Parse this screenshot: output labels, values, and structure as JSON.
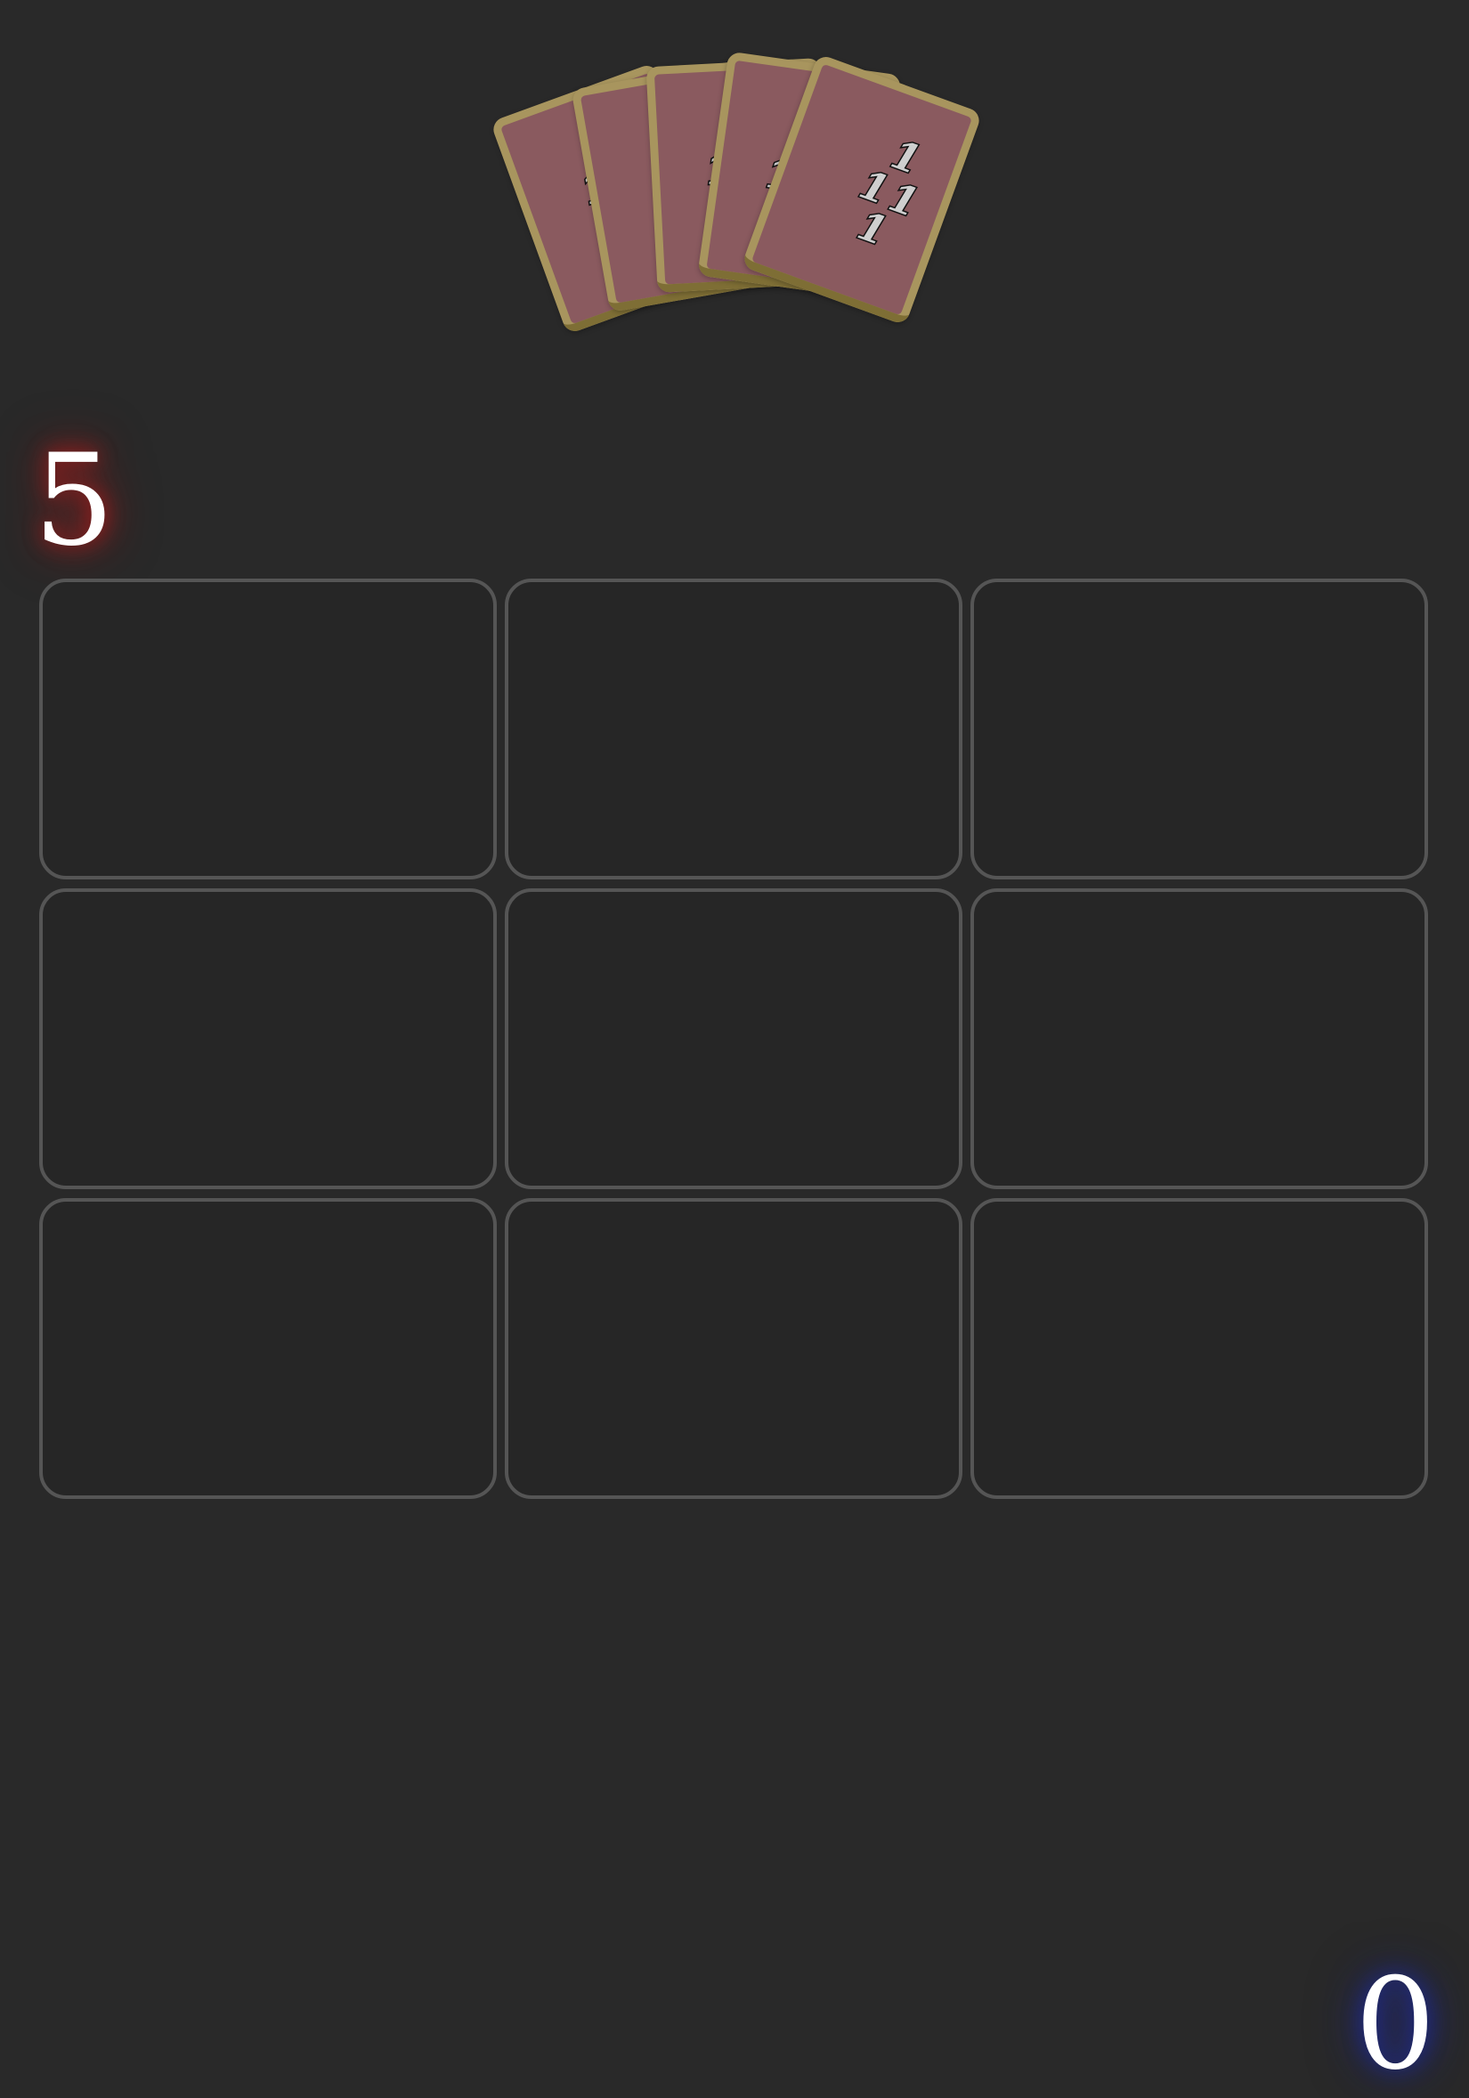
{
  "opponent": {
    "score": "5",
    "score_glow_color": "#9b1c1c",
    "hand": {
      "card_count": 5,
      "card_back_color": "#8a5a5f",
      "card_border_color": "#a8955e",
      "top_card_digits": [
        "1",
        "1",
        "1",
        "1"
      ],
      "partial_card_digits": [
        "1",
        "1",
        "1",
        "1"
      ]
    }
  },
  "player": {
    "score": "0",
    "score_glow_color": "#1e2a8c"
  },
  "board": {
    "rows": 3,
    "columns": 3,
    "slots": [
      "",
      "",
      "",
      "",
      "",
      "",
      "",
      "",
      ""
    ]
  },
  "colors": {
    "background": "#292929",
    "slot_border": "#555555"
  }
}
